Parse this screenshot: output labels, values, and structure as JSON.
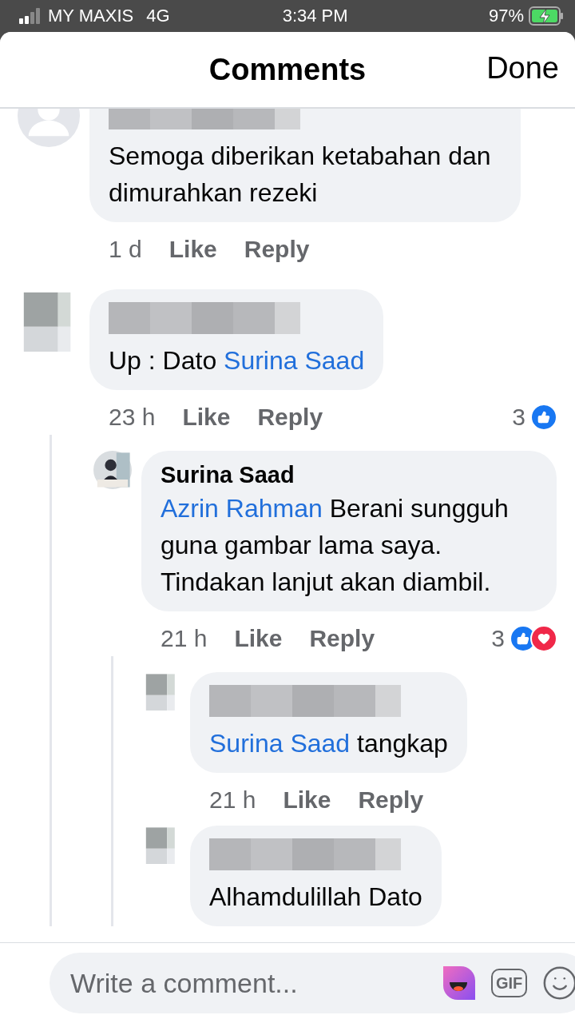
{
  "status_bar": {
    "carrier": "MY MAXIS",
    "network": "4G",
    "time": "3:34 PM",
    "battery": "97%",
    "charging": true
  },
  "header": {
    "title": "Comments",
    "done": "Done"
  },
  "comments": [
    {
      "avatar": {
        "kind": "default"
      },
      "name": {
        "kind": "blurred"
      },
      "segments": [
        {
          "text": "Semoga diberikan ketabahan dan dimurahkan rezeki",
          "mention": false
        }
      ],
      "time": "1 d",
      "like": "Like",
      "reply": "Reply"
    },
    {
      "avatar": {
        "kind": "blurred"
      },
      "name": {
        "kind": "blurred"
      },
      "segments": [
        {
          "text": "Up : Dato ",
          "mention": false
        },
        {
          "text": "Surina Saad",
          "mention": true
        }
      ],
      "time": "23 h",
      "like": "Like",
      "reply": "Reply",
      "reaction_count": "3",
      "reactions": [
        {
          "kind": "like"
        }
      ],
      "children": [
        {
          "name": {
            "kind": "text",
            "text": "Surina Saad"
          },
          "segments": [
            {
              "text": "Azrin Rahman",
              "mention": true
            },
            {
              "text": " Berani sungguh guna gambar lama saya. Tindakan lanjut akan diambil.",
              "mention": false
            }
          ],
          "time": "21 h",
          "like": "Like",
          "reply": "Reply",
          "reaction_count": "3",
          "reactions": [
            {
              "kind": "like"
            },
            {
              "kind": "love"
            }
          ],
          "children": [
            {
              "avatar": {
                "kind": "blurred"
              },
              "name": {
                "kind": "blurred"
              },
              "segments": [
                {
                  "text": "Surina Saad",
                  "mention": true
                },
                {
                  "text": " tangkap",
                  "mention": false
                }
              ],
              "time": "21 h",
              "like": "Like",
              "reply": "Reply"
            },
            {
              "avatar": {
                "kind": "blurred"
              },
              "name": {
                "kind": "blurred"
              },
              "segments": [
                {
                  "text": "Alhamdulillah Dato",
                  "mention": false
                }
              ]
            }
          ]
        }
      ]
    }
  ],
  "composer": {
    "placeholder": "Write a comment...",
    "gif": "GIF"
  }
}
